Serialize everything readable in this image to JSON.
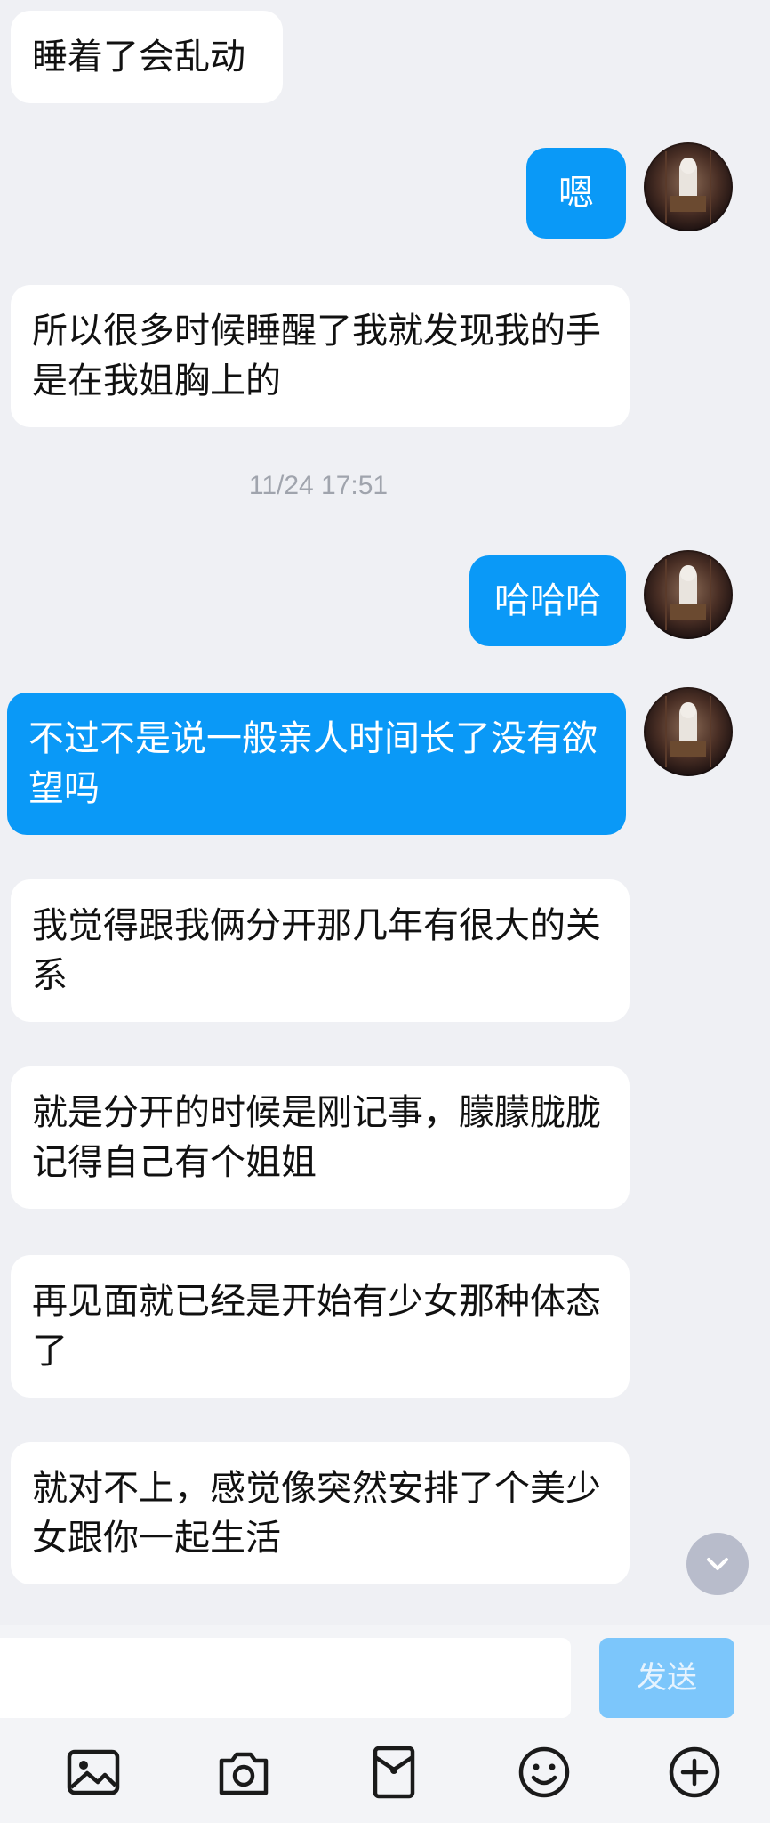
{
  "messages": [
    {
      "side": "in",
      "text": "睡着了会乱动"
    },
    {
      "side": "out",
      "text": "嗯"
    },
    {
      "side": "in",
      "text": "所以很多时候睡醒了我就发现我的手是在我姐胸上的"
    },
    {
      "side": "out",
      "text": "哈哈哈"
    },
    {
      "side": "out",
      "text": "不过不是说一般亲人时间长了没有欲望吗"
    },
    {
      "side": "in",
      "text": "我觉得跟我俩分开那几年有很大的关系"
    },
    {
      "side": "in",
      "text": "就是分开的时候是刚记事，朦朦胧胧记得自己有个姐姐"
    },
    {
      "side": "in",
      "text": "再见面就已经是开始有少女那种体态了"
    },
    {
      "side": "in",
      "text": "就对不上，感觉像突然安排了个美少女跟你一起生活"
    }
  ],
  "timestamp": "11/24 17:51",
  "input": {
    "value": "",
    "placeholder": ""
  },
  "send_label": "发送",
  "toolbar": [
    "image-icon",
    "camera-icon",
    "red-packet-icon",
    "emoji-icon",
    "plus-icon"
  ],
  "colors": {
    "outgoing_bubble": "#0a99f7",
    "incoming_bubble": "#ffffff",
    "background": "#eff0f4",
    "send_button": "#7cc6fb"
  }
}
